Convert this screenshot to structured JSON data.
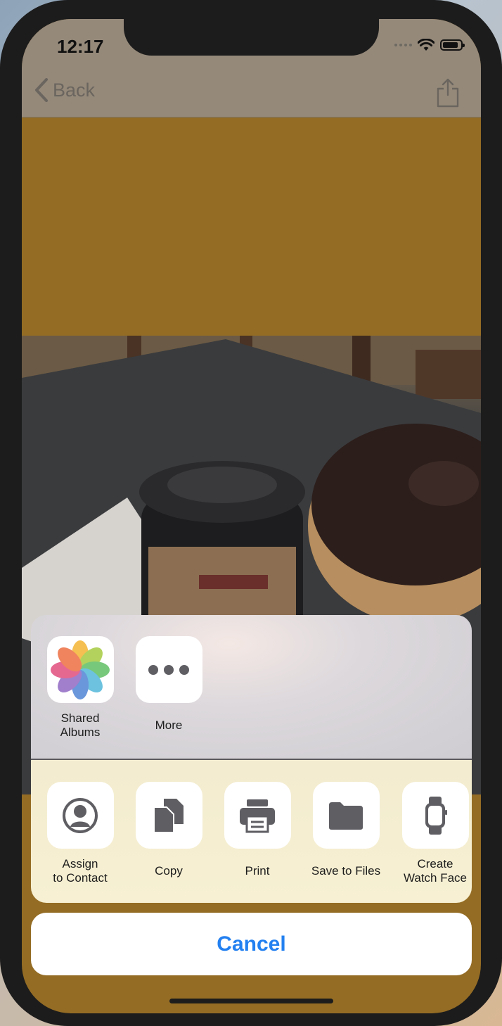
{
  "status_bar": {
    "time": "12:17"
  },
  "nav": {
    "back_label": "Back"
  },
  "share_sheet": {
    "top_row": [
      {
        "label_line1": "Shared",
        "label_line2": "Albums",
        "icon": "photos-icon"
      },
      {
        "label_line1": "More",
        "label_line2": "",
        "icon": "more-icon"
      }
    ],
    "bottom_row": [
      {
        "label_line1": "Assign",
        "label_line2": "to Contact",
        "icon": "contact-icon"
      },
      {
        "label_line1": "Copy",
        "label_line2": "",
        "icon": "copy-icon"
      },
      {
        "label_line1": "Print",
        "label_line2": "",
        "icon": "print-icon"
      },
      {
        "label_line1": "Save to Files",
        "label_line2": "",
        "icon": "folder-icon"
      },
      {
        "label_line1": "Create",
        "label_line2": "Watch Face",
        "icon": "watch-icon"
      }
    ],
    "cancel_label": "Cancel"
  },
  "colors": {
    "accent": "#2380f0",
    "background": "#946c24",
    "nav_bar": "#95897a"
  }
}
